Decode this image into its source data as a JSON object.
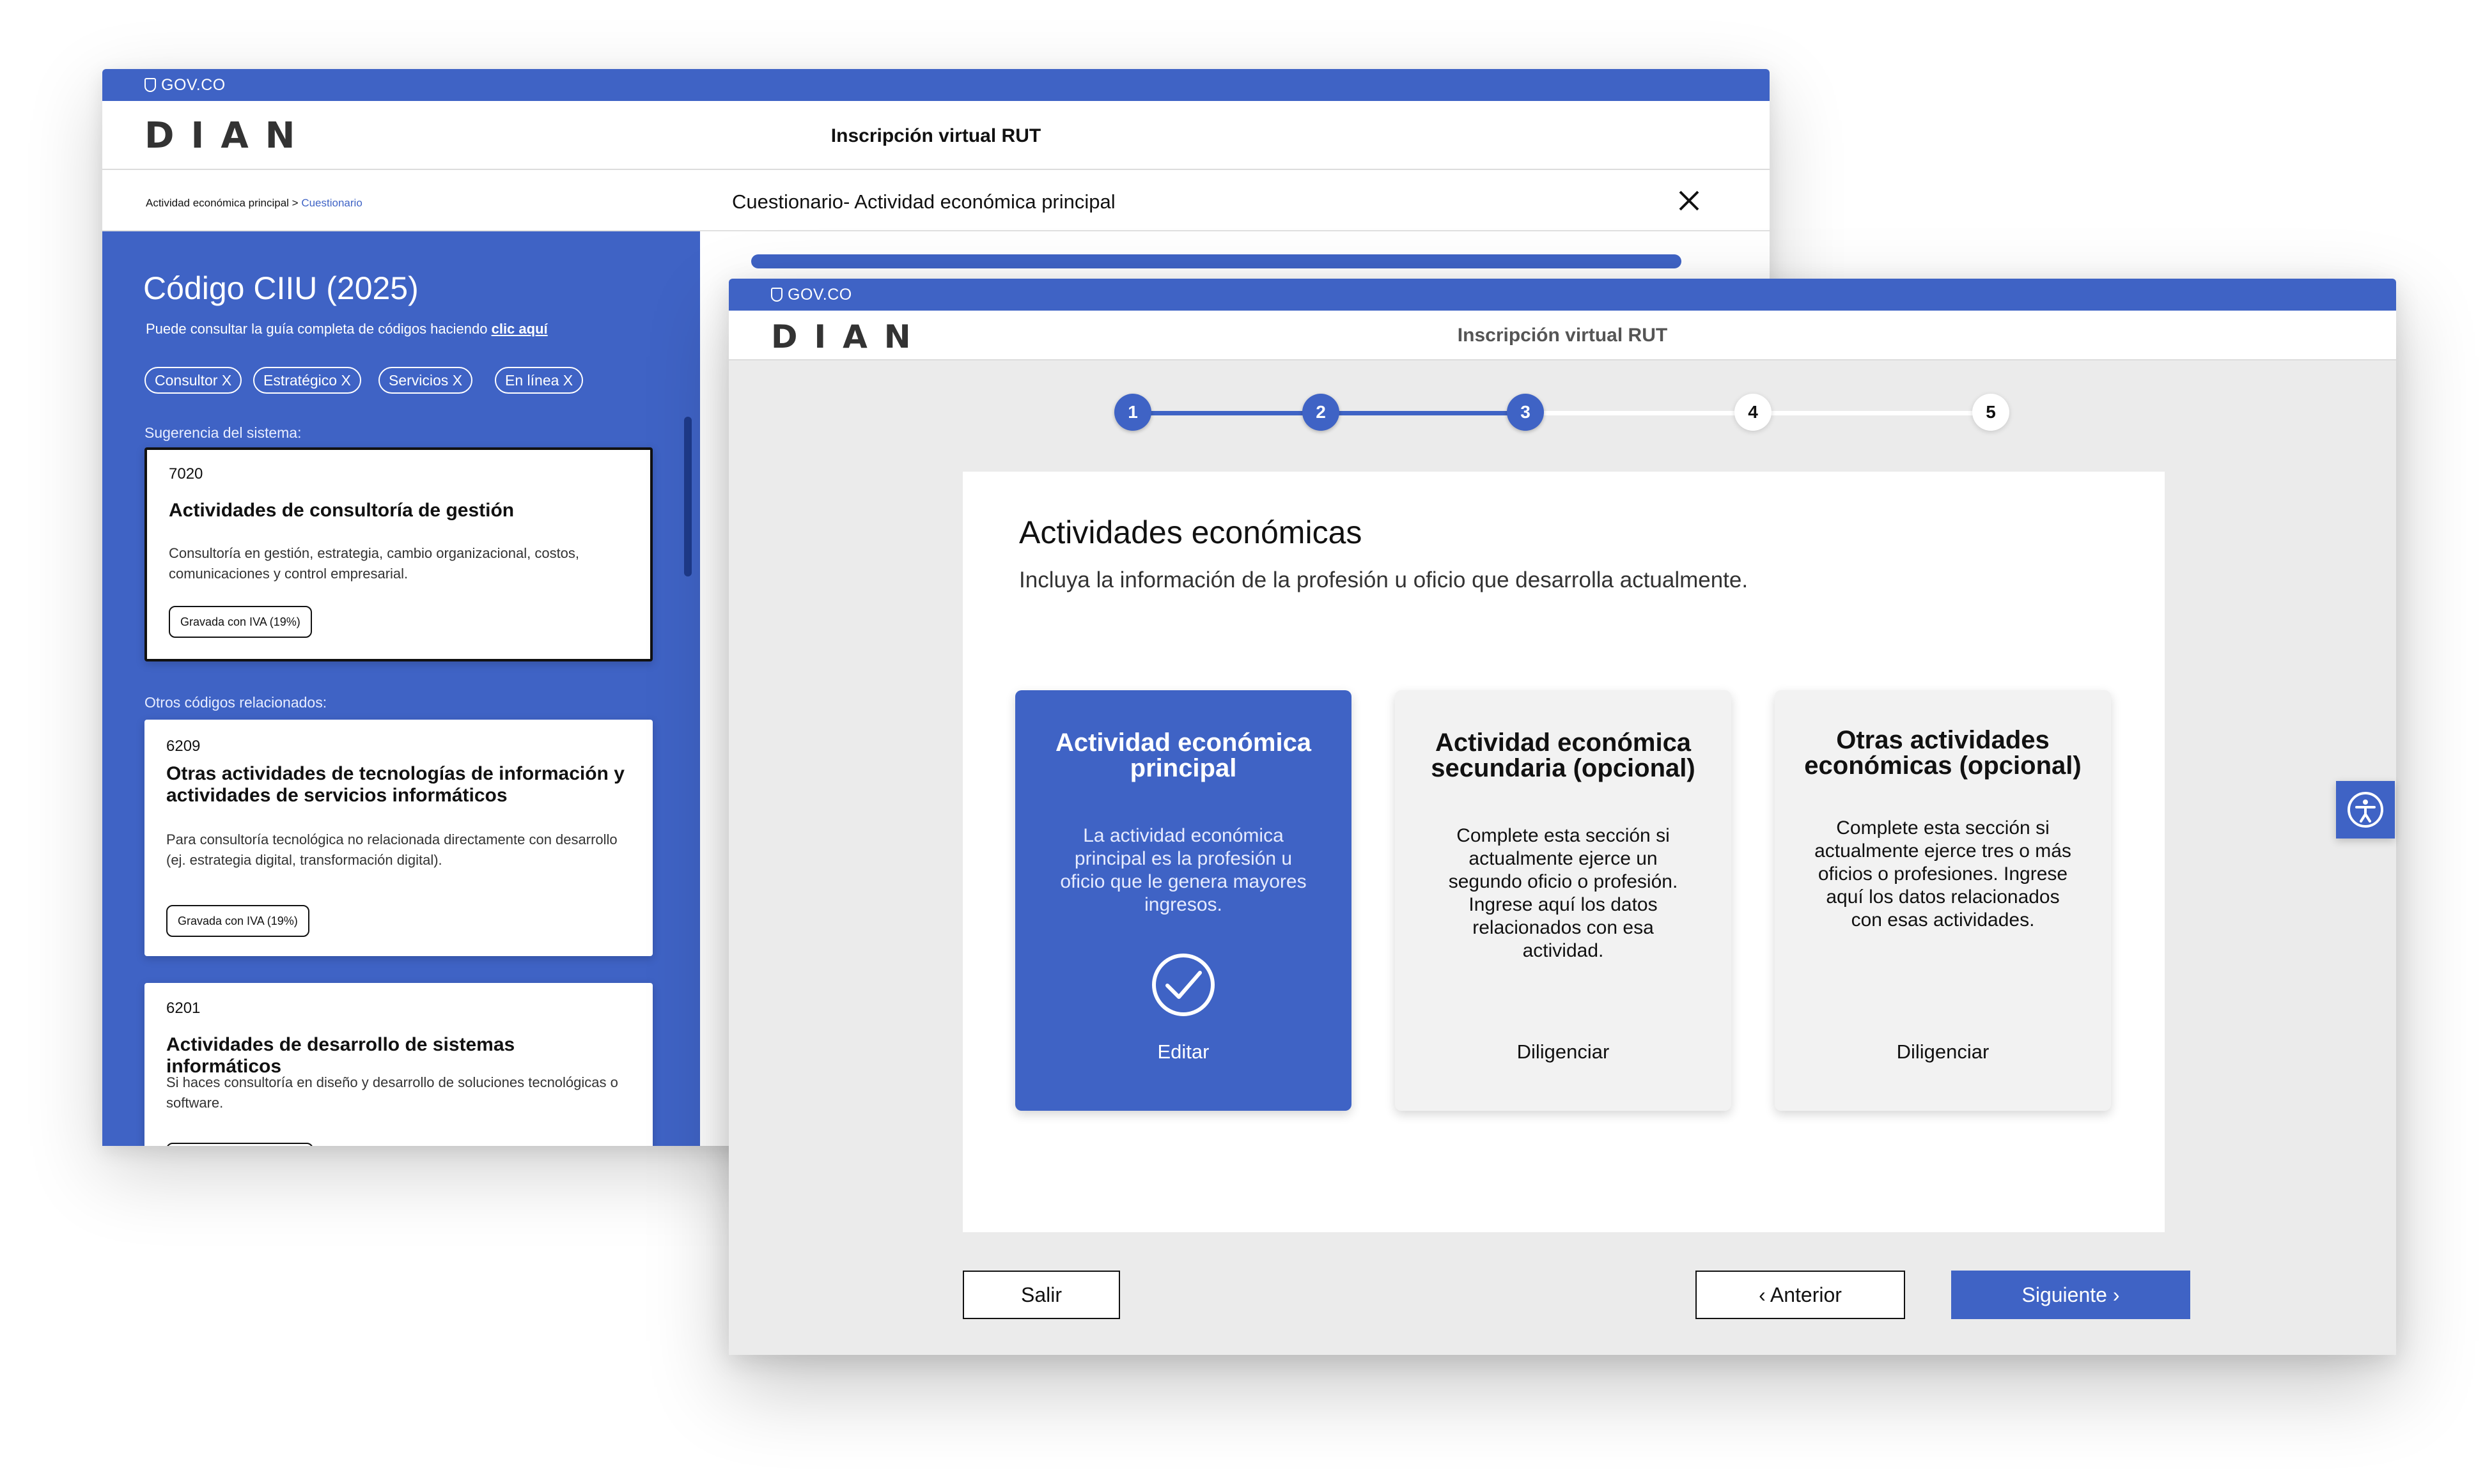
{
  "gov_label": "GOV.CO",
  "logo_text": "DIAN",
  "back": {
    "app_title": "Inscripción virtual RUT",
    "breadcrumb_parent": "Actividad económica principal",
    "breadcrumb_sep": " > ",
    "breadcrumb_current": "Cuestionario",
    "questionnaire_title": "Cuestionario- Actividad económica principal",
    "ciiu_title": "Código CIIU (2025)",
    "ciiu_subtitle": "Puede consultar la guía completa de códigos haciendo ",
    "ciiu_link": "clic aquí",
    "chips": [
      "Consultor X",
      "Estratégico X",
      "Servicios X",
      "En línea X"
    ],
    "suggestion_label": "Sugerencia del sistema:",
    "others_label": "Otros códigos relacionados:",
    "cards": [
      {
        "code": "7020",
        "title": "Actividades de consultoría de gestión",
        "description": "Consultoría en gestión, estrategia, cambio organizacional, costos, comunicaciones y control empresarial.",
        "badge": "Gravada con IVA (19%)"
      },
      {
        "code": "6209",
        "title": "Otras actividades de tecnologías de información y actividades de servicios informáticos",
        "description": "Para consultoría tecnológica no relacionada directamente con desarrollo (ej. estrategia digital, transformación digital).",
        "badge": "Gravada con IVA (19%)"
      },
      {
        "code": "6201",
        "title": "Actividades de desarrollo de sistemas informáticos",
        "description": "Si haces consultoría en diseño y desarrollo de soluciones tecnológicas o software."
      }
    ]
  },
  "front": {
    "app_title": "Inscripción virtual RUT",
    "steps": [
      {
        "label": "1",
        "state": "done"
      },
      {
        "label": "2",
        "state": "done"
      },
      {
        "label": "3",
        "state": "done"
      },
      {
        "label": "4",
        "state": "todo"
      },
      {
        "label": "5",
        "state": "todo"
      }
    ],
    "title": "Actividades económicas",
    "subtitle": "Incluya la información de la profesión u oficio que desarrolla actualmente.",
    "cards": [
      {
        "title": "Actividad económica principal",
        "description": "La actividad económica principal es la profesión u oficio que le genera mayores ingresos.",
        "action": "Editar",
        "status_icon": "check-circle-icon"
      },
      {
        "title": "Actividad económica secundaria (opcional)",
        "description": "Complete esta sección si actualmente ejerce un segundo oficio o profesión. Ingrese aquí los datos relacionados con esa actividad.",
        "action": "Diligenciar"
      },
      {
        "title": "Otras actividades económicas (opcional)",
        "description": "Complete esta sección si actualmente ejerce tres o más oficios o profesiones. Ingrese aquí los datos relacionados con esas actividades.",
        "action": "Diligenciar"
      }
    ],
    "buttons": {
      "exit": "Salir",
      "prev": "Anterior",
      "next": "Siguiente"
    }
  },
  "colors": {
    "brand_blue": "#3f63c5",
    "panel_bg": "#ebebeb",
    "card_gray": "#f2f2f2"
  }
}
